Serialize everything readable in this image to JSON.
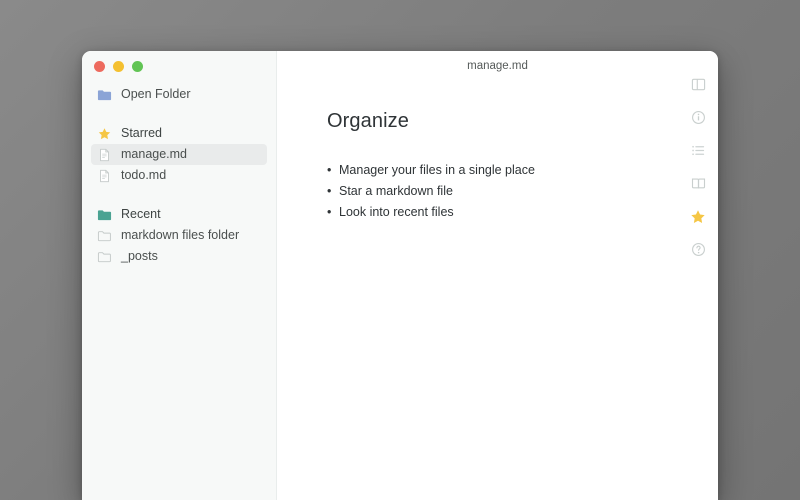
{
  "window": {
    "title": "manage.md",
    "traffic_lights": [
      {
        "name": "close-button",
        "color": "#ed6a5e"
      },
      {
        "name": "minimize-button",
        "color": "#f4c030"
      },
      {
        "name": "maximize-button",
        "color": "#61c454"
      }
    ]
  },
  "sidebar": {
    "open_folder": {
      "label": "Open Folder",
      "icon": "folder-icon",
      "color": "#8ba4d6"
    },
    "starred": {
      "label": "Starred",
      "icon": "star-icon",
      "color": "#f5c645",
      "files": [
        {
          "label": "manage.md",
          "icon": "markdown-file-icon",
          "selected": true
        },
        {
          "label": "todo.md",
          "icon": "markdown-file-icon",
          "selected": false
        }
      ]
    },
    "recent": {
      "label": "Recent",
      "icon": "folder-icon",
      "color": "#4aa392",
      "folders": [
        {
          "label": "markdown files folder",
          "icon": "folder-outline-icon"
        },
        {
          "label": "_posts",
          "icon": "folder-outline-icon"
        }
      ]
    }
  },
  "document": {
    "heading": "Organize",
    "bullets": [
      "Manager your files in a single place",
      "Star a markdown file",
      "Look into recent files"
    ]
  },
  "toolbar": {
    "items": [
      {
        "name": "sidebar-toggle-icon",
        "active": false
      },
      {
        "name": "info-icon",
        "active": false
      },
      {
        "name": "outline-list-icon",
        "active": false
      },
      {
        "name": "reading-mode-icon",
        "active": false
      },
      {
        "name": "star-icon",
        "active": true
      },
      {
        "name": "help-icon",
        "active": false
      }
    ],
    "accent_color": "#f5c645",
    "idle_color": "#c9cfce"
  }
}
